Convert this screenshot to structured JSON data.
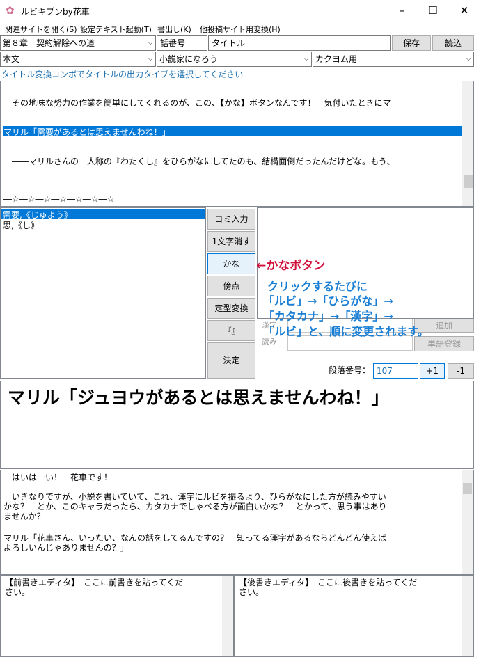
{
  "window": {
    "title": "ルビキブンby花車",
    "minimize": "–",
    "maximize": "☐",
    "close": "✕"
  },
  "menu": [
    {
      "label": "関連サイトを開く(S)"
    },
    {
      "label": "設定テキスト起動(T)"
    },
    {
      "label": "書出し(K)"
    },
    {
      "label": "他投稿サイト用変換(H)"
    }
  ],
  "row1": {
    "chapter": "第８章　契約解除への道",
    "episode_no": "話番号",
    "title_field": "タイトル",
    "save_label": "保存",
    "load_label": "読込"
  },
  "row2": {
    "body_type": "本文",
    "site": "小説家になろう",
    "output": "カクヨム用"
  },
  "hint": "タイトル変換コンボでタイトルの出力タイプを選択してください",
  "main_text": {
    "lines": [
      "　その地味な努力の作業を簡単にしてくれるのが、この、【かな】ボタンなんです！　気付いたときにマ",
      "マリル「需要があるとは思えませんわね！」",
      "　――マリルさんの一人称の『わたくし』をひらがなにしてたのも、結構面倒だったんだけどな。もう、",
      "―☆―☆―☆―☆―☆―☆―☆"
    ]
  },
  "ruby_list": {
    "items": [
      "需要,《じゅよう》",
      "思,《し》"
    ]
  },
  "buttons": {
    "yomi": "ヨミ入力",
    "delete_one": "1文字消す",
    "kana": "かな",
    "bouten": "傍点",
    "teikei": "定型変換",
    "bracket": "『』",
    "kettei": "決定",
    "tango": "単語登録",
    "plus": "+1",
    "minus": "-1"
  },
  "fields": {
    "kanji_label": "漢字",
    "yomi_label": "読み",
    "add_label": "追加",
    "paragraph_label": "段落番号：",
    "paragraph_value": "107"
  },
  "annotation": {
    "kana_arrow": "←かなボタン",
    "line1": "クリックするたびに",
    "line2": "「ルビ」→「ひらがな」→",
    "line3": "「カタカナ」→「漢字」→",
    "line4": "「ルビ」と、順に変更されます。"
  },
  "preview": {
    "text": "マリル「ジュヨウがあるとは思えませんわね！」"
  },
  "body_editor": {
    "lines": [
      "　はいはーい！　花車です！",
      "　いきなりですが、小説を書いていて、これ、漢字にルビを振るより、ひらがなにした方が読みやすい",
      "かな？　とか、このキャラだったら、カタカナでしゃべる方が面白いかな？　とかって、思う事はあり",
      "ませんか？",
      "マリル「花車さん、いったい、なんの話をしてるんですの？　知ってる漢字があるならどんどん使えば",
      "よろしいんじゃありませんの？」"
    ]
  },
  "fore_editor": {
    "line1": "【前書きエディタ】　ここに前書きを貼ってくだ",
    "line2": "さい。"
  },
  "after_editor": {
    "line1": "【後書きエディタ】　ここに後書きを貼ってくだ",
    "line2": "さい。"
  },
  "icons": {
    "app": "sakura-icon",
    "dropdown": "chevron-down-icon"
  },
  "colors": {
    "selection": "#0078d7",
    "hint_text": "#1a6fb0",
    "annotation_red": "#d0103a",
    "annotation_blue": "#1a7fd4"
  }
}
